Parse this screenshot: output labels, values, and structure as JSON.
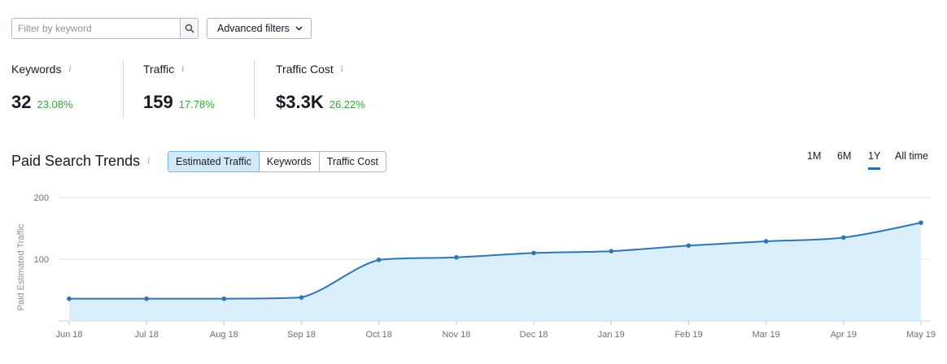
{
  "filters": {
    "search_placeholder": "Filter by keyword",
    "advanced_label": "Advanced filters"
  },
  "metrics": [
    {
      "label": "Keywords",
      "value": "32",
      "delta": "23.08%"
    },
    {
      "label": "Traffic",
      "value": "159",
      "delta": "17.78%"
    },
    {
      "label": "Traffic Cost",
      "value": "$3.3K",
      "delta": "26.22%"
    }
  ],
  "trends": {
    "title": "Paid Search Trends",
    "tabs": [
      "Estimated Traffic",
      "Keywords",
      "Traffic Cost"
    ],
    "active_tab": "Estimated Traffic",
    "periods": [
      "1M",
      "6M",
      "1Y",
      "All time"
    ],
    "active_period": "1Y"
  },
  "colors": {
    "line": "#2e75b6",
    "fill": "#dbeefb",
    "positive": "#3aa33a"
  },
  "chart_data": {
    "type": "area",
    "ylabel": "Paid Estimated Traffic",
    "xlabel": "",
    "categories": [
      "Jun 18",
      "Jul 18",
      "Aug 18",
      "Sep 18",
      "Oct 18",
      "Nov 18",
      "Dec 18",
      "Jan 19",
      "Feb 19",
      "Mar 19",
      "Apr 19",
      "May 19"
    ],
    "values": [
      36,
      36,
      36,
      38,
      99,
      103,
      110,
      113,
      122,
      129,
      135,
      159
    ],
    "yticks": [
      100,
      200
    ],
    "ylim": [
      0,
      200
    ],
    "grid": true,
    "legend": "none"
  }
}
